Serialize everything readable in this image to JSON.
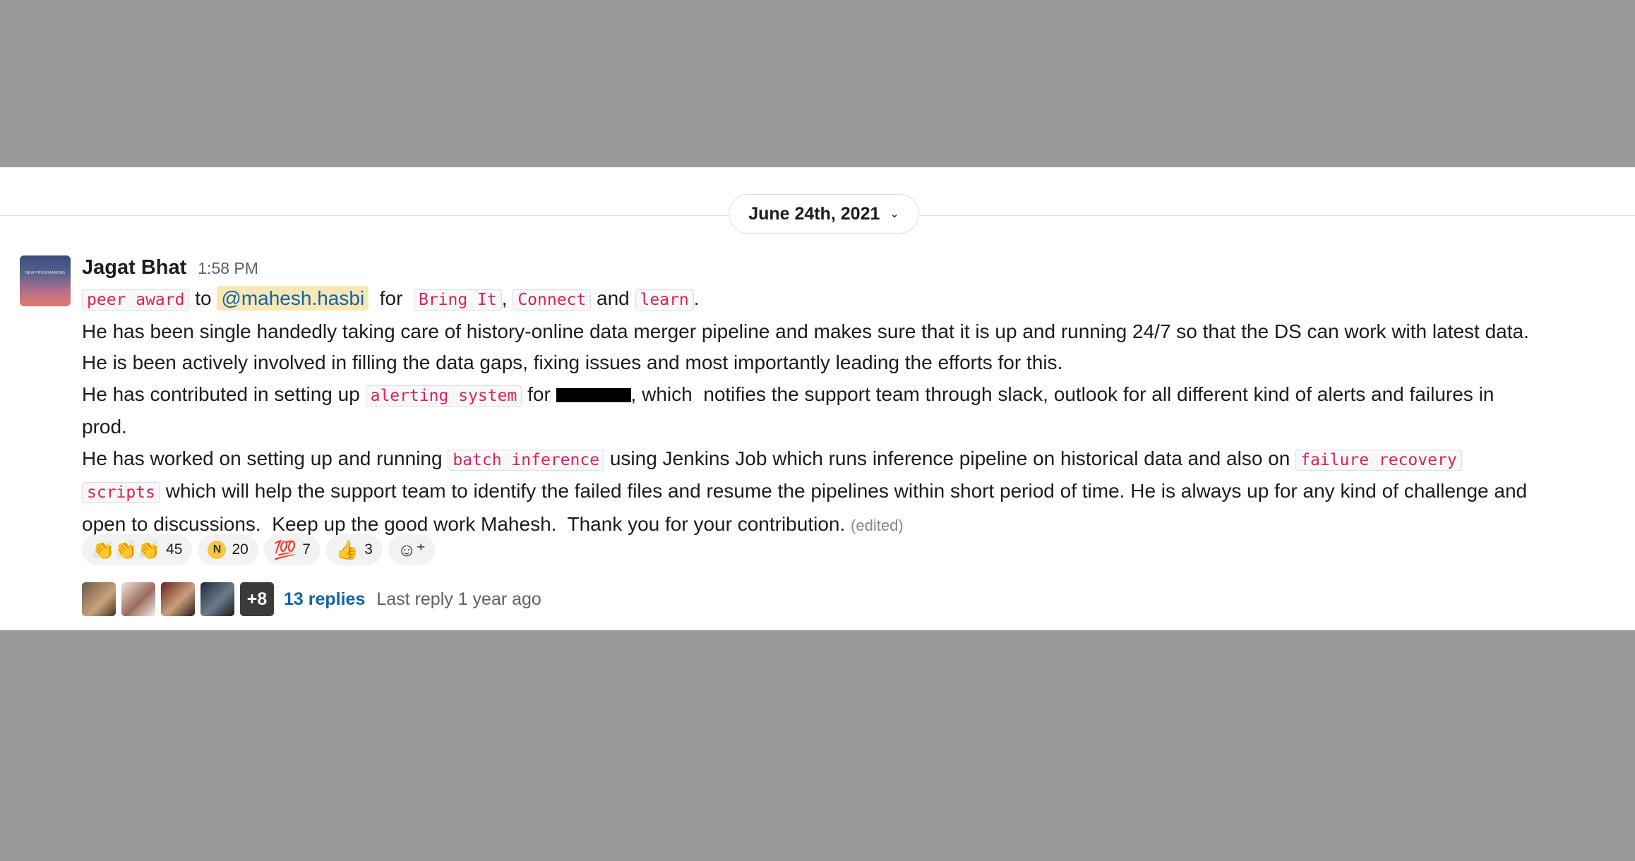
{
  "date_divider": {
    "label": "June 24th, 2021",
    "chevron": "⌄"
  },
  "message": {
    "author": "Jagat Bhat",
    "time": "1:58 PM",
    "avatar_text": "NEW PROGRAMMING",
    "line1": {
      "code_peer_award": "peer award",
      "to": " to ",
      "mention": "@mahesh.hasbi",
      "for": "  for  ",
      "code_bring_it": "Bring It",
      "comma": ", ",
      "code_connect": "Connect",
      "and": " and ",
      "code_learn": "learn",
      "period": "."
    },
    "line2": "He has been single handedly taking care of history-online data merger pipeline and makes sure that it is up and running 24/7 so that the DS can work with latest data.",
    "line3": "He is been actively involved in filling the data gaps, fixing issues and most importantly leading the efforts for this.",
    "line4": {
      "pre": "He has contributed in setting up ",
      "code_alerting": "alerting system",
      "for": " for ",
      "post": ", which  notifies the support team through slack, outlook for all different kind of alerts and failures in"
    },
    "line5": "prod.",
    "line6": {
      "pre": "He has worked on setting up and running ",
      "code_batch": "batch inference",
      "mid": " using Jenkins Job which runs inference pipeline on historical data and also on ",
      "code_failure": "failure recovery"
    },
    "line7": {
      "code_scripts": "scripts",
      "post": " which will help the support team to identify the failed files and resume the pipelines within short period of time. He is always up for any kind of challenge and"
    },
    "line8": {
      "text": "open to discussions.  Keep up the good work Mahesh.  Thank you for your contribution. ",
      "edited": "(edited)"
    }
  },
  "reactions": [
    {
      "icon": "clapping-hands-icon",
      "glyph": "👏👏👏",
      "count": "45"
    },
    {
      "icon": "n-badge-icon",
      "glyph": "N",
      "count": "20"
    },
    {
      "icon": "hundred-points-icon",
      "glyph": "💯",
      "count": "7"
    },
    {
      "icon": "thumbs-up-icon",
      "glyph": "👍",
      "count": "3"
    }
  ],
  "add_reaction_glyph": "☺⁺",
  "thread": {
    "more_count": "+8",
    "replies_label": "13 replies",
    "last_reply": "Last reply 1 year ago"
  }
}
